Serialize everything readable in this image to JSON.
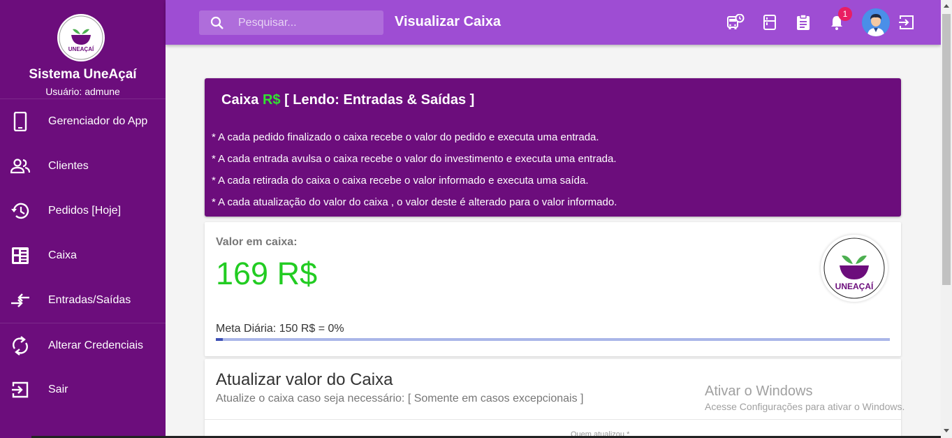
{
  "sidebar": {
    "title": "Sistema UneAçaí",
    "user": "Usuário: admune",
    "logo_text": "UNEAÇAÍ",
    "items": [
      {
        "label": "Gerenciador do App",
        "icon": "smartphone-icon"
      },
      {
        "label": "Clientes",
        "icon": "people-icon"
      },
      {
        "label": "Pedidos [Hoje]",
        "icon": "history-icon"
      },
      {
        "label": "Caixa",
        "icon": "dashboard-icon"
      },
      {
        "label": "Entradas/Saídas",
        "icon": "compare-arrows-icon"
      },
      {
        "label": "Alterar Credenciais",
        "icon": "sync-icon"
      },
      {
        "label": "Sair",
        "icon": "exit-icon"
      }
    ]
  },
  "header": {
    "search_placeholder": "Pesquisar...",
    "title": "Visualizar Caixa",
    "notification_count": "1",
    "icons": [
      "bus-clock-icon",
      "kitchen-icon",
      "clipboard-icon",
      "bell-icon",
      "avatar",
      "logout-icon"
    ]
  },
  "info": {
    "title_prefix": "Caixa ",
    "title_currency": "R$",
    "title_suffix": " [ Lendo: Entradas & Saídas ]",
    "lines": [
      "* A cada pedido finalizado o caixa recebe o valor do pedido e executa uma entrada.",
      "* A cada entrada avulsa o caixa recebe o valor do investimento e executa uma entrada.",
      "* A cada retirada do caixa o caixa recebe o valor informado e executa uma saída.",
      "* A cada atualização do valor do caixa , o valor deste é alterado para o valor informado."
    ]
  },
  "value_card": {
    "label": "Valor em caixa:",
    "amount": "169 R$",
    "logo_text": "UNEAÇAÍ",
    "meta_text": "Meta Diária: 150 R$ = 0%",
    "progress_fraction": 0.01
  },
  "update_card": {
    "title": "Atualizar valor do Caixa",
    "subtitle": "Atualize o caixa caso seja necessário: [ Somente em casos excepcionais ]",
    "field_label": "Quem atualizou *"
  },
  "watermark": {
    "title": "Ativar o Windows",
    "subtitle": "Acesse Configurações para ativar o Windows."
  },
  "colors": {
    "sidebar": "#6c0d7c",
    "header": "#9e4dd3",
    "accent_green": "#22cc22"
  }
}
